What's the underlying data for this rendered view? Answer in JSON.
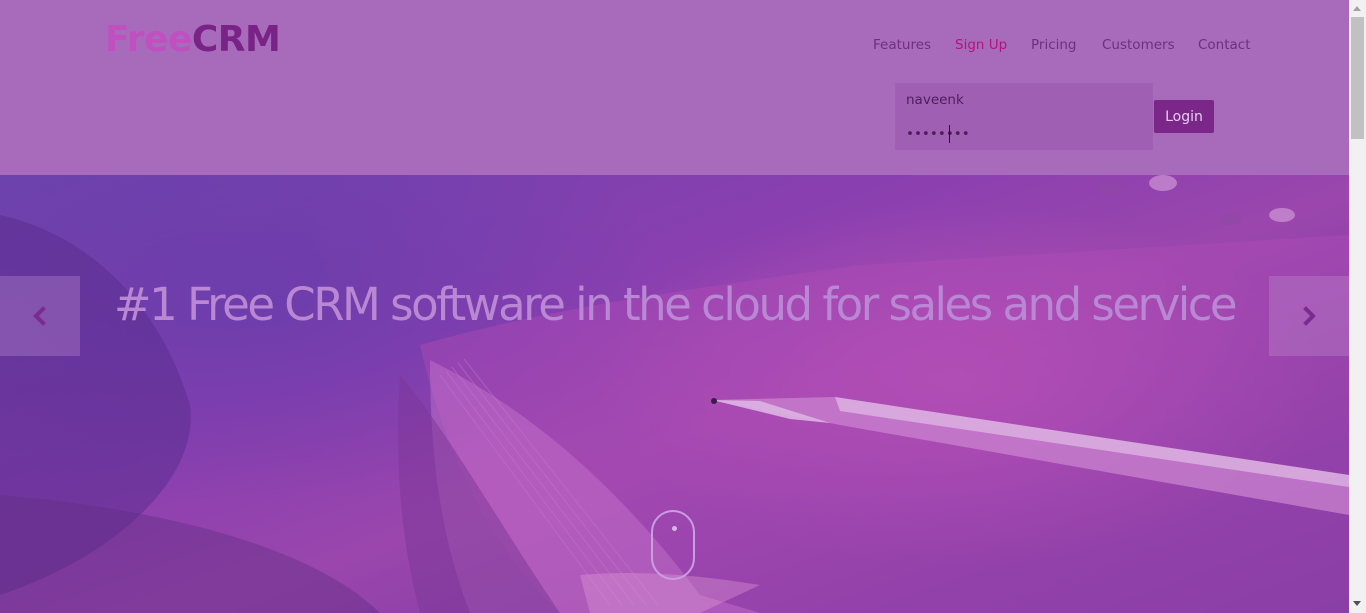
{
  "brand": {
    "part1": "Free",
    "part2": "CRM"
  },
  "nav": {
    "features": "Features",
    "signup": "Sign Up",
    "pricing": "Pricing",
    "customers": "Customers",
    "contact": "Contact"
  },
  "login": {
    "username_value": "naveenk",
    "password_value": "••••••••",
    "button_label": "Login"
  },
  "hero": {
    "headline": "#1 Free CRM software in the cloud for sales and service",
    "prev_icon": "chevron-left-icon",
    "next_icon": "chevron-right-icon",
    "scroll_icon": "mouse-scroll-icon"
  },
  "colors": {
    "header_bg": "#a86bbb",
    "brand_free": "#c04fc0",
    "brand_crm": "#7a2386",
    "nav_text": "#6f2e7f",
    "nav_active": "#b3137e",
    "login_button": "#7a2789",
    "headline": "#b987d4"
  }
}
